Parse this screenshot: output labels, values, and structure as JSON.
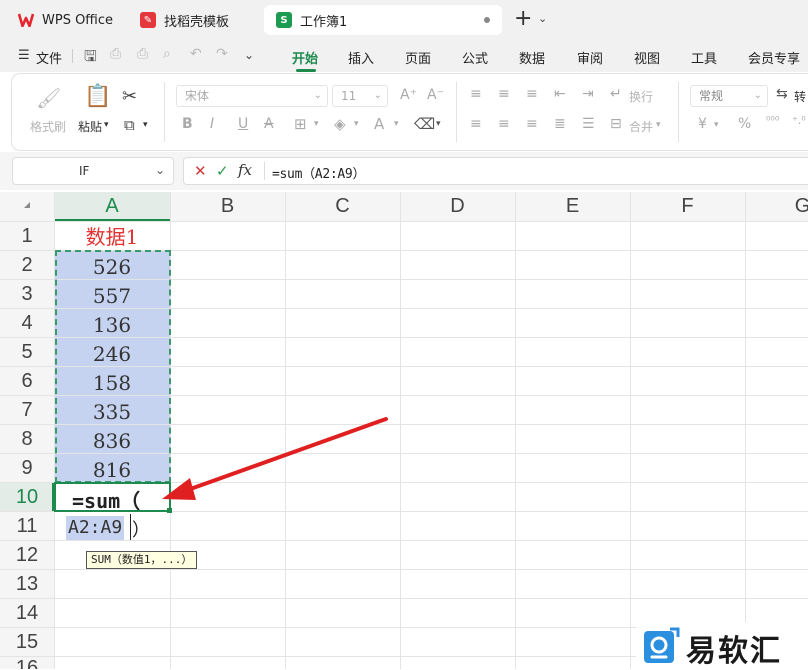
{
  "tabs": [
    {
      "label": "WPS Office",
      "icon": "wps-logo-icon"
    },
    {
      "label": "找稻壳模板",
      "icon": "docer-icon"
    },
    {
      "label": "工作簿1",
      "icon": "spreadsheet-icon"
    }
  ],
  "menu": {
    "file": "文件",
    "items": [
      "开始",
      "插入",
      "页面",
      "公式",
      "数据",
      "审阅",
      "视图",
      "工具",
      "会员专享"
    ],
    "active": "开始"
  },
  "ribbon": {
    "format_painter": "格式刷",
    "paste": "粘贴",
    "font_name": "宋体",
    "font_size": "11",
    "wrap": "换行",
    "merge": "合并",
    "number_format": "常规",
    "convert": "转"
  },
  "formula_bar": {
    "name_box": "IF",
    "fx": "fx",
    "formula": "=sum（A2:A9）"
  },
  "sheet": {
    "columns": [
      "A",
      "B",
      "C",
      "D",
      "E",
      "F",
      "G"
    ],
    "rows": [
      "1",
      "2",
      "3",
      "4",
      "5",
      "6",
      "7",
      "8",
      "9",
      "10",
      "11",
      "12",
      "13",
      "14",
      "15",
      "16"
    ],
    "header_cell": "数据1",
    "values": [
      "526",
      "557",
      "136",
      "246",
      "158",
      "335",
      "836",
      "816"
    ],
    "edit_text": "=sum（",
    "edit_ref": "A2:A9",
    "edit_close": "）",
    "tooltip": "SUM（数值1，...）"
  },
  "watermark": {
    "text": "易软汇"
  },
  "colors": {
    "accent": "#1e8b4e",
    "selection": "#c6d3f0",
    "header_red": "#e23232",
    "arrow": "#e02020"
  }
}
